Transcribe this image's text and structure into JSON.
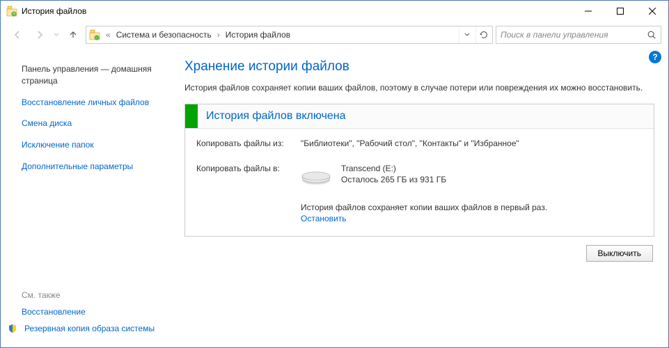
{
  "window": {
    "title": "История файлов"
  },
  "breadcrumb": {
    "part1": "Система и безопасность",
    "part2": "История файлов"
  },
  "search": {
    "placeholder": "Поиск в панели управления"
  },
  "sidebar": {
    "home": "Панель управления — домашняя страница",
    "links": [
      "Восстановление личных файлов",
      "Смена диска",
      "Исключение папок",
      "Дополнительные параметры"
    ],
    "see_also_title": "См. также",
    "see_also": [
      {
        "label": "Восстановление",
        "shield": false
      },
      {
        "label": "Резервная копия образа системы",
        "shield": true
      }
    ]
  },
  "main": {
    "heading": "Хранение истории файлов",
    "desc": "История файлов сохраняет копии ваших файлов, поэтому в случае потери или повреждения их можно восстановить.",
    "status_title": "История файлов включена",
    "copy_from_label": "Копировать файлы из:",
    "copy_from_value": "\"Библиотеки\", \"Рабочий стол\", \"Контакты\" и \"Избранное\"",
    "copy_to_label": "Копировать файлы в:",
    "drive": {
      "name": "Transcend (E:)",
      "free": "Осталось 265 ГБ из 931 ГБ"
    },
    "first_copy": "История файлов сохраняет копии ваших файлов в первый раз.",
    "stop": "Остановить",
    "turn_off": "Выключить"
  },
  "help": "?"
}
